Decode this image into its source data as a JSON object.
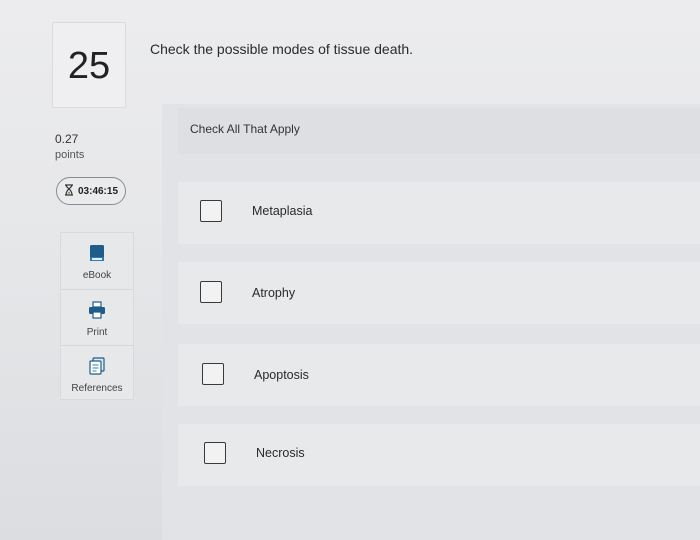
{
  "question": {
    "number": "25",
    "points_value": "0.27",
    "points_label": "points",
    "timer": "03:46:15",
    "prompt": "Check the possible modes of tissue death.",
    "instruction": "Check All That Apply"
  },
  "tools": [
    {
      "label": "eBook",
      "icon": "book-icon"
    },
    {
      "label": "Print",
      "icon": "printer-icon"
    },
    {
      "label": "References",
      "icon": "references-icon"
    }
  ],
  "options": [
    {
      "label": "Metaplasia",
      "checked": false
    },
    {
      "label": "Atrophy",
      "checked": false
    },
    {
      "label": "Apoptosis",
      "checked": false
    },
    {
      "label": "Necrosis",
      "checked": false
    }
  ],
  "colors": {
    "tool_icon": "#1f5c8a",
    "checkbox_border": "#3a3a3a"
  }
}
